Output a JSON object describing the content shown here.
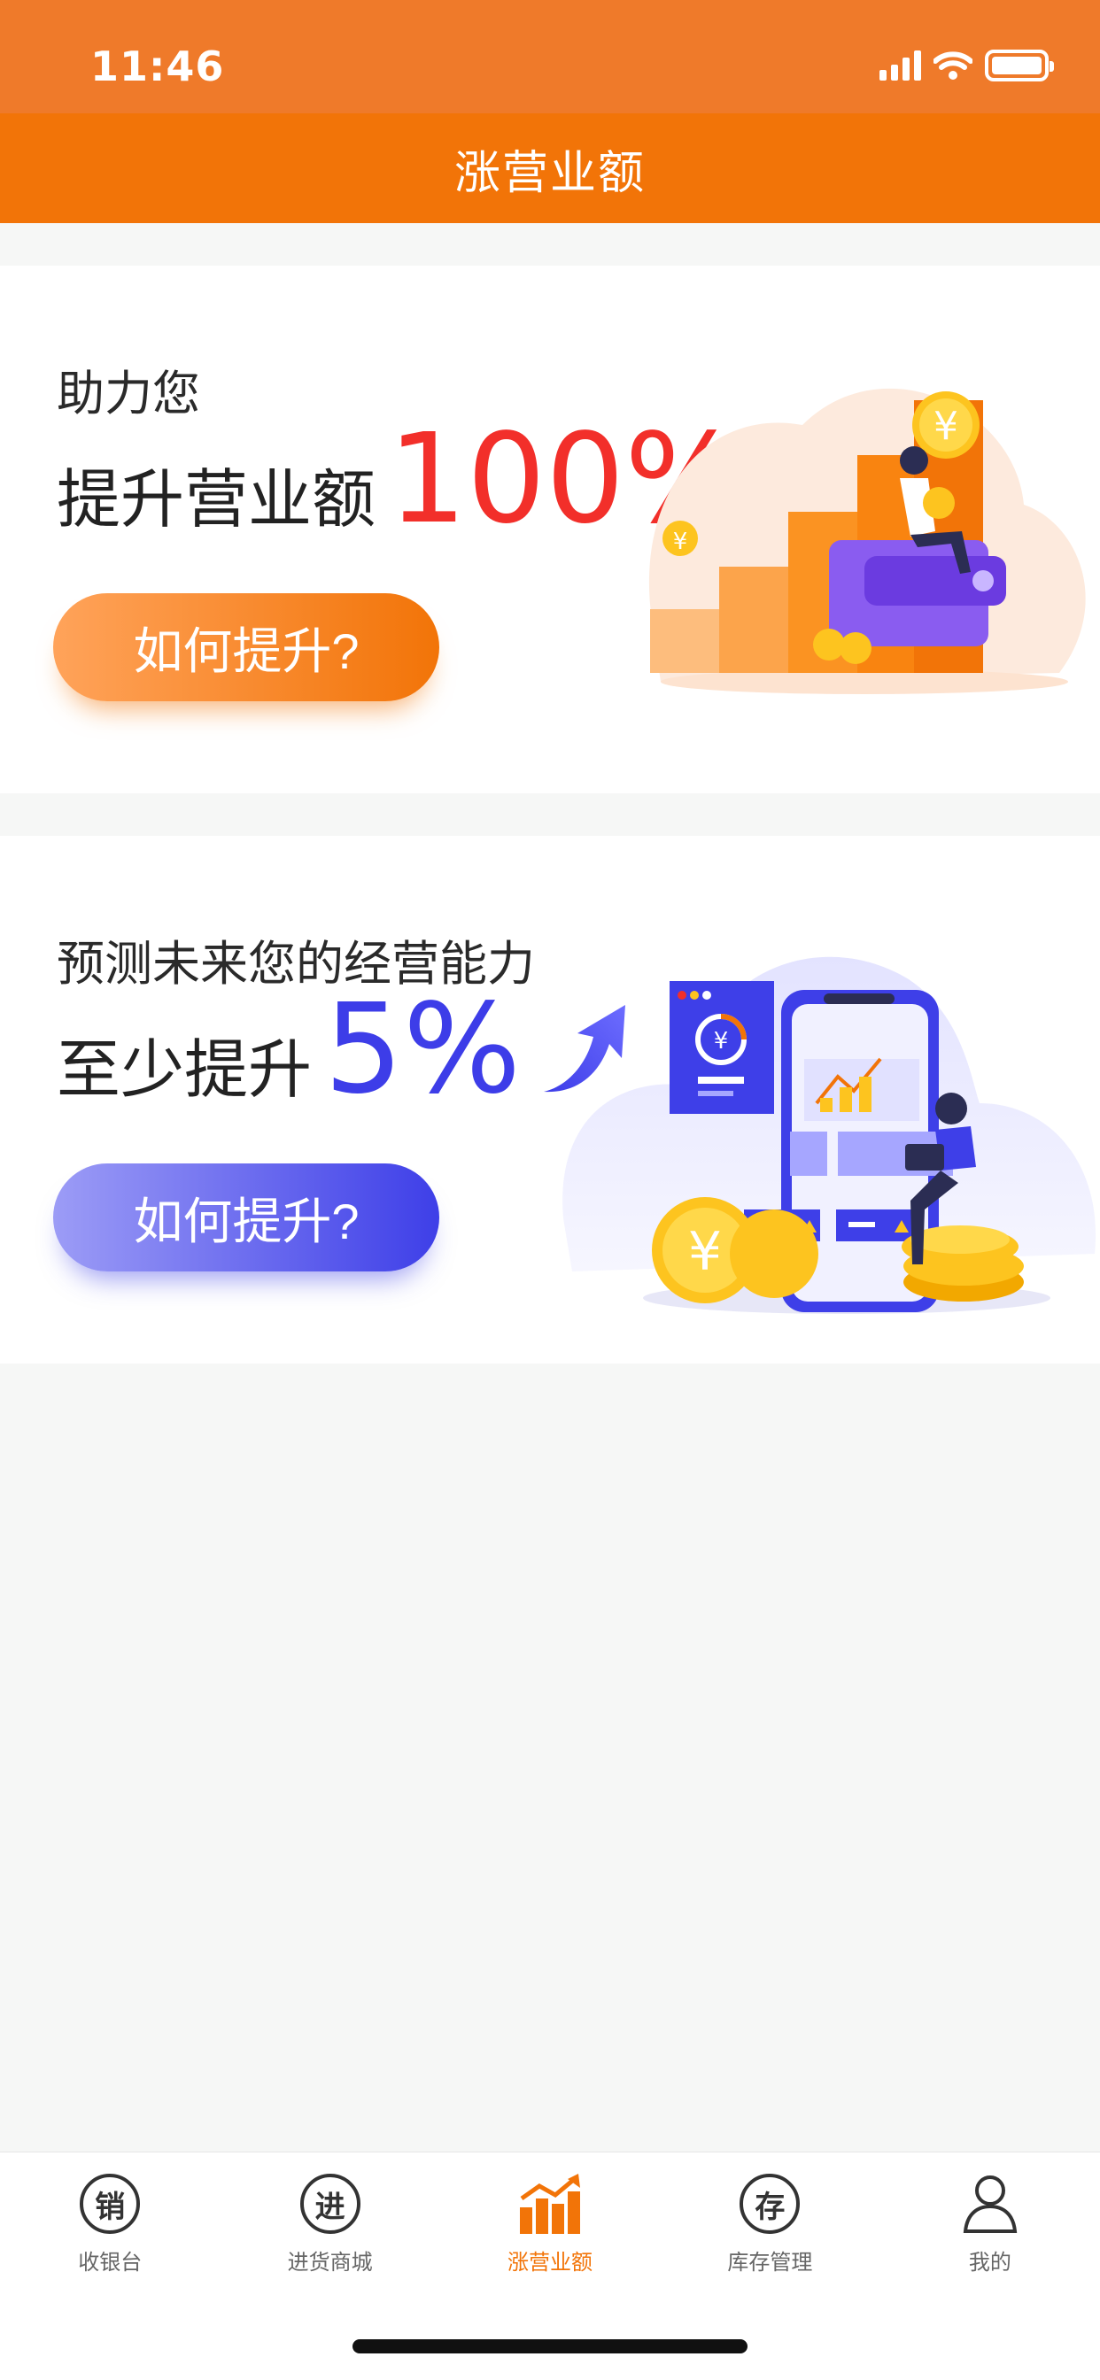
{
  "status_bar": {
    "time": "11:46",
    "colors": {
      "background": "#ef7a2a"
    }
  },
  "header": {
    "title": "涨营业额",
    "color": "#f27408"
  },
  "card1": {
    "subtitle": "助力您",
    "headline": "提升营业额",
    "highlight": "100%",
    "highlight_color": "#f22f2a",
    "cta_label": "如何提升?"
  },
  "card2": {
    "subtitle": "预测未来您的经营能力",
    "headline": "至少提升",
    "highlight": "5%",
    "highlight_color": "#3d3de8",
    "cta_label": "如何提升?"
  },
  "tabbar": {
    "items": [
      {
        "label": "收银台",
        "icon": "cashier-icon",
        "glyph": "销",
        "active": false
      },
      {
        "label": "进货商城",
        "icon": "purchase-mall-icon",
        "glyph": "进",
        "active": false
      },
      {
        "label": "涨营业额",
        "icon": "growth-chart-icon",
        "glyph": "",
        "active": true
      },
      {
        "label": "库存管理",
        "icon": "inventory-icon",
        "glyph": "存",
        "active": false
      },
      {
        "label": "我的",
        "icon": "user-profile-icon",
        "glyph": "",
        "active": false
      }
    ],
    "active_color": "#f27408"
  }
}
